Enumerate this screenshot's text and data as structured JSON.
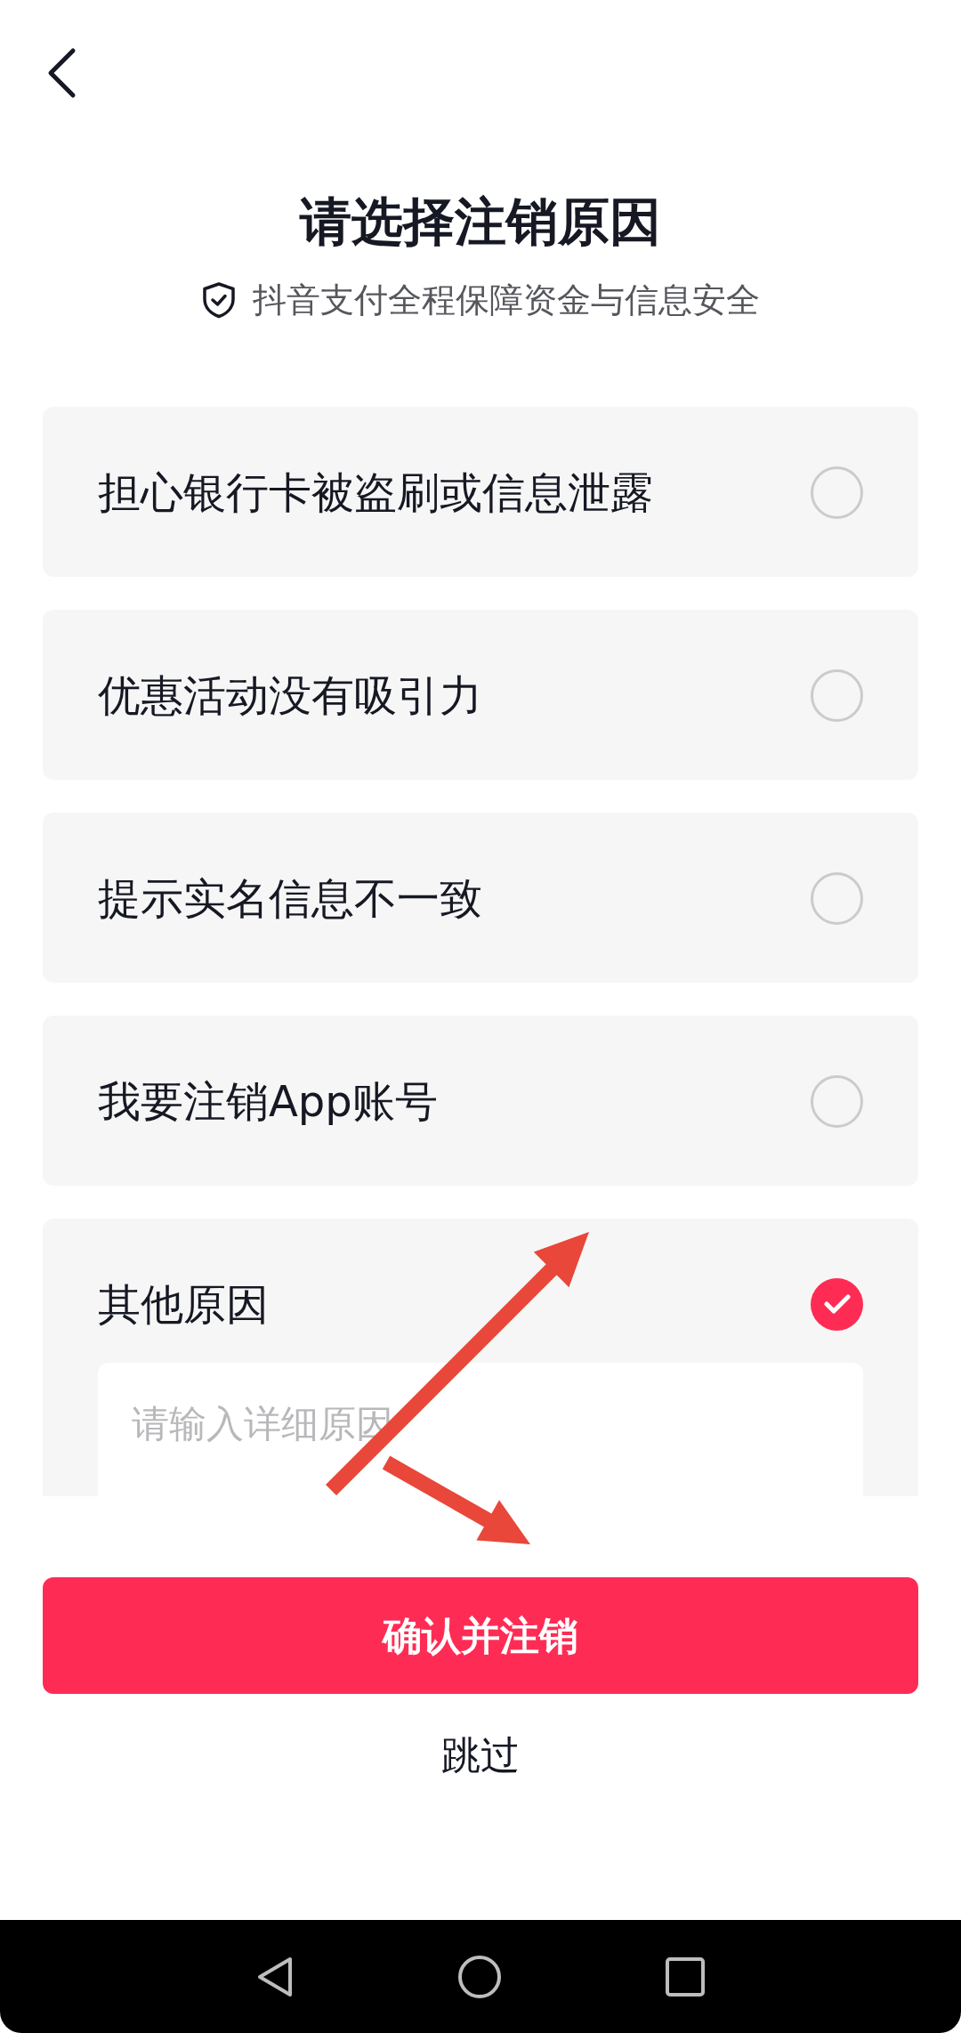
{
  "header": {
    "title": "请选择注销原因",
    "subtitle": "抖音支付全程保障资金与信息安全"
  },
  "reasons": [
    {
      "label": "担心银行卡被盗刷或信息泄露",
      "selected": false
    },
    {
      "label": "优惠活动没有吸引力",
      "selected": false
    },
    {
      "label": "提示实名信息不一致",
      "selected": false
    },
    {
      "label": "我要注销App账号",
      "selected": false
    },
    {
      "label": "其他原因",
      "selected": true,
      "detail_field": {
        "placeholder": "请输入详细原因"
      }
    }
  ],
  "confirm_button": {
    "label": "确认并注销"
  },
  "skip_link": {
    "label": "跳过"
  }
}
